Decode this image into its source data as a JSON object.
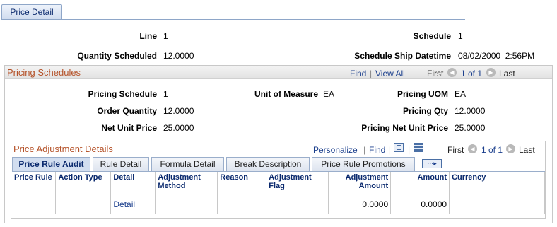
{
  "tab": {
    "label": "Price Detail"
  },
  "header": {
    "line_label": "Line",
    "line_value": "1",
    "schedule_label": "Schedule",
    "schedule_value": "1",
    "qty_sched_label": "Quantity Scheduled",
    "qty_sched_value": "12.0000",
    "ship_dt_label": "Schedule Ship Datetime",
    "ship_dt_value": "08/02/2000  2:56PM"
  },
  "pricing_schedules": {
    "title": "Pricing Schedules",
    "find": "Find",
    "separator": "|",
    "view_all": "View All",
    "first": "First",
    "page_info": "1 of 1",
    "last": "Last",
    "fields": {
      "pricing_schedule_label": "Pricing Schedule",
      "pricing_schedule_value": "1",
      "uom_label": "Unit of Measure",
      "uom_value": "EA",
      "pricing_uom_label": "Pricing UOM",
      "pricing_uom_value": "EA",
      "order_qty_label": "Order Quantity",
      "order_qty_value": "12.0000",
      "pricing_qty_label": "Pricing Qty",
      "pricing_qty_value": "12.0000",
      "net_unit_price_label": "Net Unit Price",
      "net_unit_price_value": "25.0000",
      "pricing_net_unit_price_label": "Pricing Net Unit Price",
      "pricing_net_unit_price_value": "25.0000"
    }
  },
  "adjustments": {
    "title": "Price Adjustment Details",
    "personalize": "Personalize",
    "find": "Find",
    "first": "First",
    "page_info": "1 of 1",
    "last": "Last",
    "tabs": [
      {
        "label": "Price Rule Audit",
        "active": true
      },
      {
        "label": "Rule Detail"
      },
      {
        "label": "Formula Detail"
      },
      {
        "label": "Break Description"
      },
      {
        "label": "Price Rule Promotions"
      }
    ],
    "columns": [
      "Price Rule",
      "Action Type",
      "Detail",
      "Adjustment Method",
      "Reason",
      "Adjustment Flag",
      "Adjustment Amount",
      "Amount",
      "Currency"
    ],
    "rows": [
      {
        "price_rule": "",
        "action_type": "",
        "detail": "Detail",
        "adj_method": "",
        "reason": "",
        "adj_flag": "",
        "adj_amount": "0.0000",
        "amount": "0.0000",
        "currency": ""
      }
    ]
  }
}
